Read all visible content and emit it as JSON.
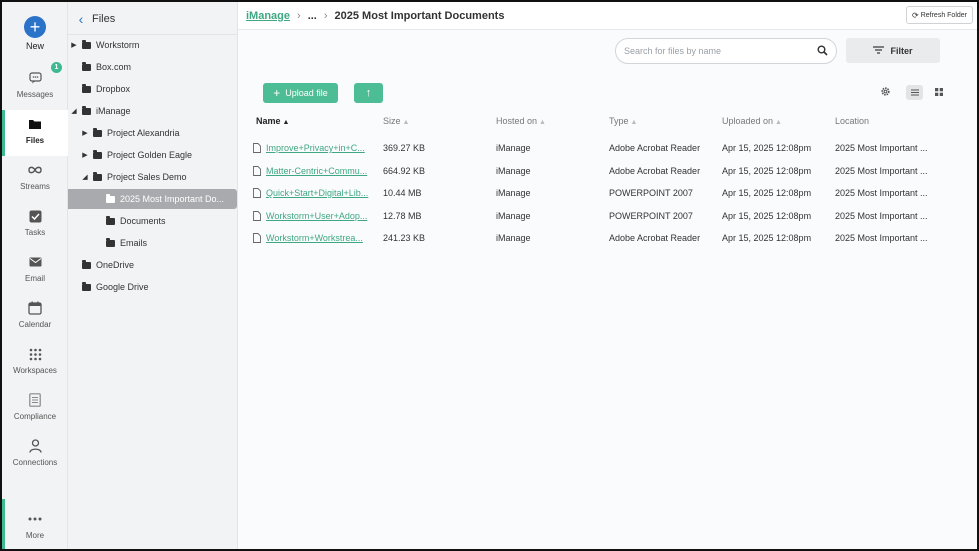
{
  "rail": {
    "new_label": "New",
    "messages_label": "Messages",
    "messages_badge": "1",
    "files_label": "Files",
    "streams_label": "Streams",
    "tasks_label": "Tasks",
    "email_label": "Email",
    "calendar_label": "Calendar",
    "workspaces_label": "Workspaces",
    "compliance_label": "Compliance",
    "connections_label": "Connections",
    "more_label": "More"
  },
  "tree": {
    "title": "Files",
    "nodes": [
      {
        "label": "Workstorm"
      },
      {
        "label": "Box.com"
      },
      {
        "label": "Dropbox"
      },
      {
        "label": "iManage"
      },
      {
        "label": "Project Alexandria"
      },
      {
        "label": "Project Golden Eagle"
      },
      {
        "label": "Project Sales Demo"
      },
      {
        "label": "2025 Most Important Do..."
      },
      {
        "label": "Documents"
      },
      {
        "label": "Emails"
      },
      {
        "label": "OneDrive"
      },
      {
        "label": "Google Drive"
      }
    ]
  },
  "breadcrumb": {
    "root": "iManage",
    "ellipsis": "...",
    "current": "2025 Most Important Documents"
  },
  "toolbar": {
    "refresh_label": "Refresh Folder",
    "search_placeholder": "Search for files by name",
    "filter_label": "Filter",
    "upload_label": "Upload file"
  },
  "table": {
    "headers": {
      "name": "Name",
      "size": "Size",
      "hosted_on": "Hosted on",
      "type": "Type",
      "uploaded_on": "Uploaded on",
      "location": "Location"
    },
    "rows": [
      {
        "name": "Improve+Privacy+in+C...",
        "size": "369.27 KB",
        "hosted_on": "iManage",
        "type": "Adobe Acrobat Reader",
        "uploaded_on": "Apr 15, 2025 12:08pm",
        "location": "2025 Most Important ..."
      },
      {
        "name": "Matter-Centric+Commu...",
        "size": "664.92 KB",
        "hosted_on": "iManage",
        "type": "Adobe Acrobat Reader",
        "uploaded_on": "Apr 15, 2025 12:08pm",
        "location": "2025 Most Important ..."
      },
      {
        "name": "Quick+Start+Digital+Lib...",
        "size": "10.44 MB",
        "hosted_on": "iManage",
        "type": "POWERPOINT 2007",
        "uploaded_on": "Apr 15, 2025 12:08pm",
        "location": "2025 Most Important ..."
      },
      {
        "name": "Workstorm+User+Adop...",
        "size": "12.78 MB",
        "hosted_on": "iManage",
        "type": "POWERPOINT 2007",
        "uploaded_on": "Apr 15, 2025 12:08pm",
        "location": "2025 Most Important ..."
      },
      {
        "name": "Workstorm+Workstrea...",
        "size": "241.23 KB",
        "hosted_on": "iManage",
        "type": "Adobe Acrobat Reader",
        "uploaded_on": "Apr 15, 2025 12:08pm",
        "location": "2025 Most Important ..."
      }
    ]
  },
  "colors": {
    "accent": "#3fb98f",
    "new_button": "#2a73c8",
    "link": "#3fa882",
    "selected_node": "#a8aaad"
  }
}
